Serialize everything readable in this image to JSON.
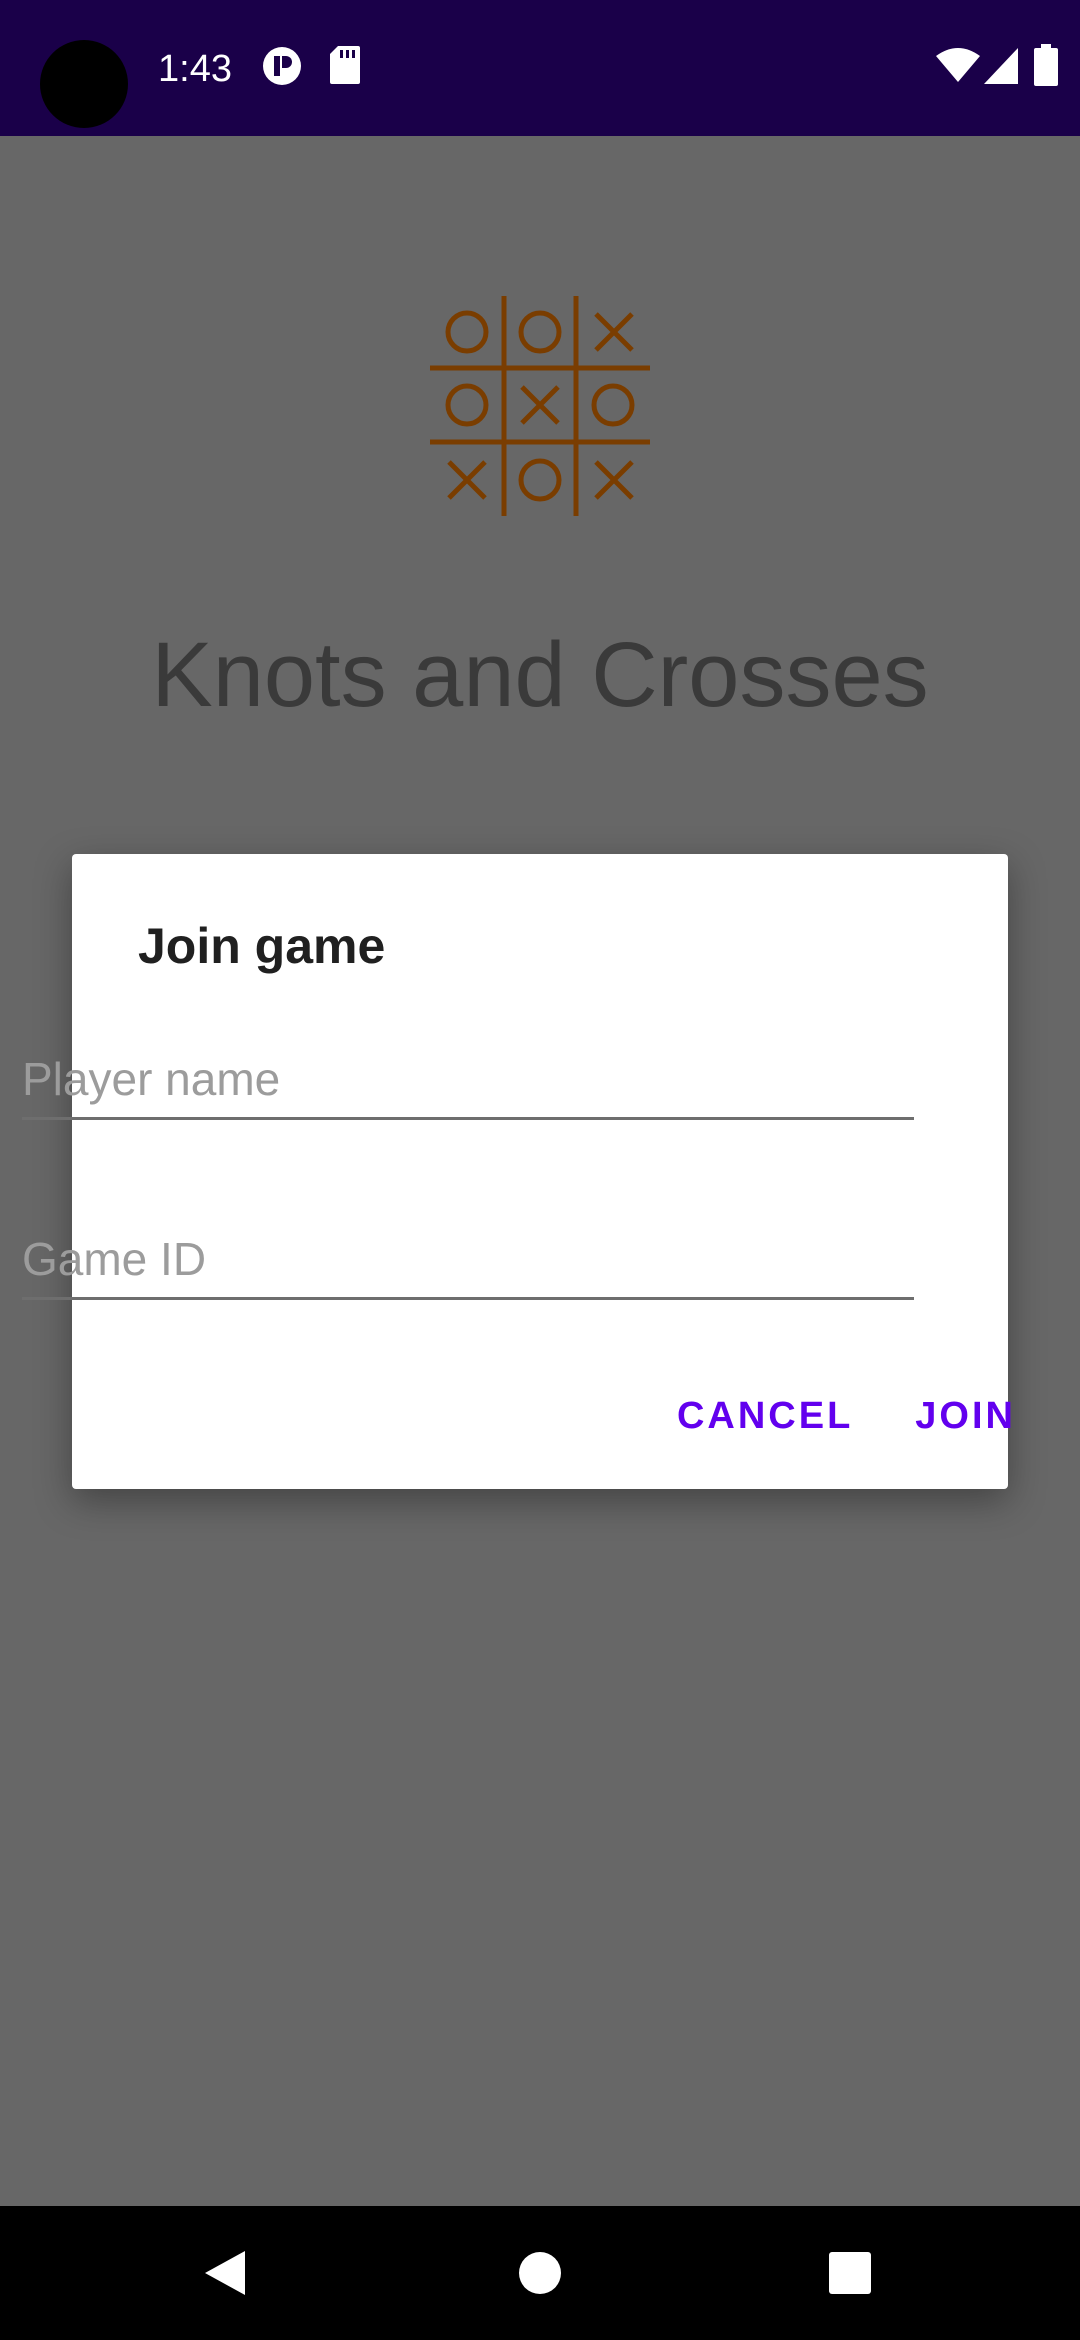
{
  "status_bar": {
    "time": "1:43",
    "icons": [
      "notification-app-icon",
      "sd-card-icon",
      "wifi-icon",
      "cell-signal-icon",
      "battery-icon"
    ],
    "background": "#1a0049"
  },
  "app": {
    "title": "Knots and Crosses",
    "logo_icon": "tic-tac-toe-board-icon",
    "logo_color": "#7a3d00",
    "background": "#676767"
  },
  "dialog": {
    "title": "Join game",
    "fields": {
      "player_name": {
        "value": "",
        "placeholder": "Player name"
      },
      "game_id": {
        "value": "",
        "placeholder": "Game ID"
      }
    },
    "buttons": {
      "cancel": "CANCEL",
      "join": "JOIN"
    },
    "accent": "#6200ee"
  },
  "nav_bar": {
    "icons": [
      "back-icon",
      "home-icon",
      "recents-icon"
    ]
  }
}
